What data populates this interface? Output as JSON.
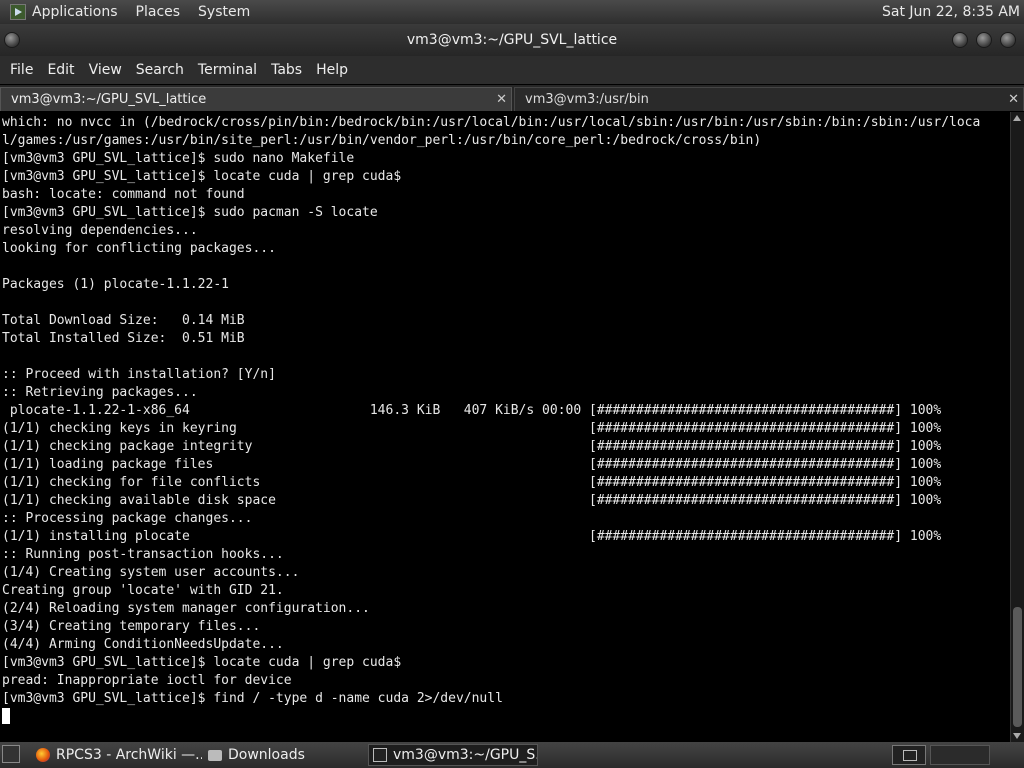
{
  "topbar": {
    "menus": [
      "Applications",
      "Places",
      "System"
    ],
    "clock": "Sat Jun 22, 8:35 AM"
  },
  "window": {
    "title": "vm3@vm3:~/GPU_SVL_lattice"
  },
  "menubar": [
    "File",
    "Edit",
    "View",
    "Search",
    "Terminal",
    "Tabs",
    "Help"
  ],
  "tabs": [
    {
      "label": "vm3@vm3:~/GPU_SVL_lattice",
      "close": "✕"
    },
    {
      "label": "vm3@vm3:/usr/bin",
      "close": "✕"
    }
  ],
  "terminal": {
    "lines": [
      "which: no nvcc in (/bedrock/cross/pin/bin:/bedrock/bin:/usr/local/bin:/usr/local/sbin:/usr/bin:/usr/sbin:/bin:/sbin:/usr/loca",
      "l/games:/usr/games:/usr/bin/site_perl:/usr/bin/vendor_perl:/usr/bin/core_perl:/bedrock/cross/bin)",
      "[vm3@vm3 GPU_SVL_lattice]$ sudo nano Makefile",
      "[vm3@vm3 GPU_SVL_lattice]$ locate cuda | grep cuda$",
      "bash: locate: command not found",
      "[vm3@vm3 GPU_SVL_lattice]$ sudo pacman -S locate",
      "resolving dependencies...",
      "looking for conflicting packages...",
      "",
      "Packages (1) plocate-1.1.22-1",
      "",
      "Total Download Size:   0.14 MiB",
      "Total Installed Size:  0.51 MiB",
      "",
      ":: Proceed with installation? [Y/n]",
      ":: Retrieving packages...",
      " plocate-1.1.22-1-x86_64                       146.3 KiB   407 KiB/s 00:00 [######################################] 100%",
      "(1/1) checking keys in keyring                                             [######################################] 100%",
      "(1/1) checking package integrity                                           [######################################] 100%",
      "(1/1) loading package files                                                [######################################] 100%",
      "(1/1) checking for file conflicts                                          [######################################] 100%",
      "(1/1) checking available disk space                                        [######################################] 100%",
      ":: Processing package changes...",
      "(1/1) installing plocate                                                   [######################################] 100%",
      ":: Running post-transaction hooks...",
      "(1/4) Creating system user accounts...",
      "Creating group 'locate' with GID 21.",
      "(2/4) Reloading system manager configuration...",
      "(3/4) Creating temporary files...",
      "(4/4) Arming ConditionNeedsUpdate...",
      "[vm3@vm3 GPU_SVL_lattice]$ locate cuda | grep cuda$",
      "pread: Inappropriate ioctl for device",
      "[vm3@vm3 GPU_SVL_lattice]$ find / -type d -name cuda 2>/dev/null"
    ]
  },
  "taskbar": {
    "items": [
      {
        "label": "RPCS3 - ArchWiki —...",
        "icon": "firefox-icon"
      },
      {
        "label": "Downloads",
        "icon": "folder-icon"
      },
      {
        "label": "vm3@vm3:~/GPU_S...",
        "icon": "terminal-icon"
      }
    ]
  }
}
